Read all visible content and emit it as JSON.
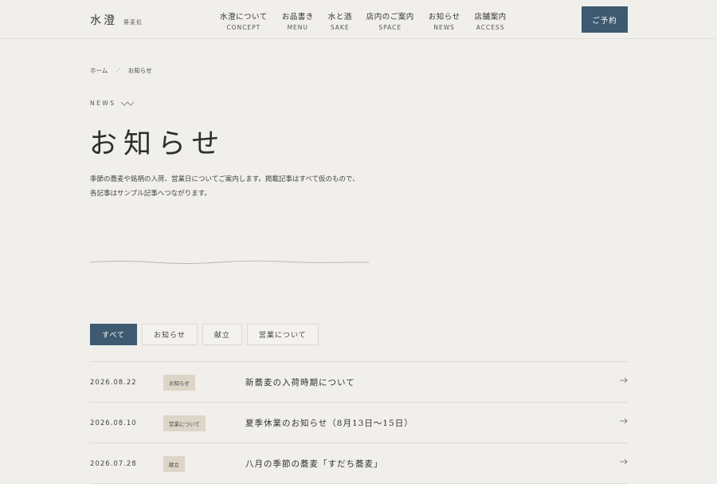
{
  "header": {
    "logo_main": "水澄",
    "logo_sub": "蕎麦処",
    "nav": [
      {
        "jp": "水澄について",
        "en": "CONCEPT"
      },
      {
        "jp": "お品書き",
        "en": "MENU"
      },
      {
        "jp": "水と酒",
        "en": "SAKE"
      },
      {
        "jp": "店内のご案内",
        "en": "SPACE"
      },
      {
        "jp": "お知らせ",
        "en": "NEWS"
      },
      {
        "jp": "店舗案内",
        "en": "ACCESS"
      }
    ],
    "reserve_label": "ご予約"
  },
  "breadcrumb": {
    "home": "ホーム",
    "separator": "／",
    "current": "お知らせ"
  },
  "section_label": "NEWS",
  "page_title": "お知らせ",
  "intro": {
    "line1": "季節の蕎麦や銘柄の入荷、営業日についてご案内します。掲載記事はすべて仮のもので、",
    "line2": "各記事はサンプル記事へつながります。"
  },
  "tabs": [
    {
      "label": "すべて",
      "active": true
    },
    {
      "label": "お知らせ",
      "active": false
    },
    {
      "label": "献立",
      "active": false
    },
    {
      "label": "営業について",
      "active": false
    }
  ],
  "news": [
    {
      "date": "2026.08.22",
      "category": "お知らせ",
      "title": "新蕎麦の入荷時期について"
    },
    {
      "date": "2026.08.10",
      "category": "営業について",
      "title": "夏季休業のお知らせ（8月13日〜15日）"
    },
    {
      "date": "2026.07.28",
      "category": "献立",
      "title": "八月の季節の蕎麦「すだち蕎麦」"
    }
  ],
  "colors": {
    "accent": "#3d5a70",
    "background": "#f1efeb",
    "badge": "#dcd5c8"
  }
}
